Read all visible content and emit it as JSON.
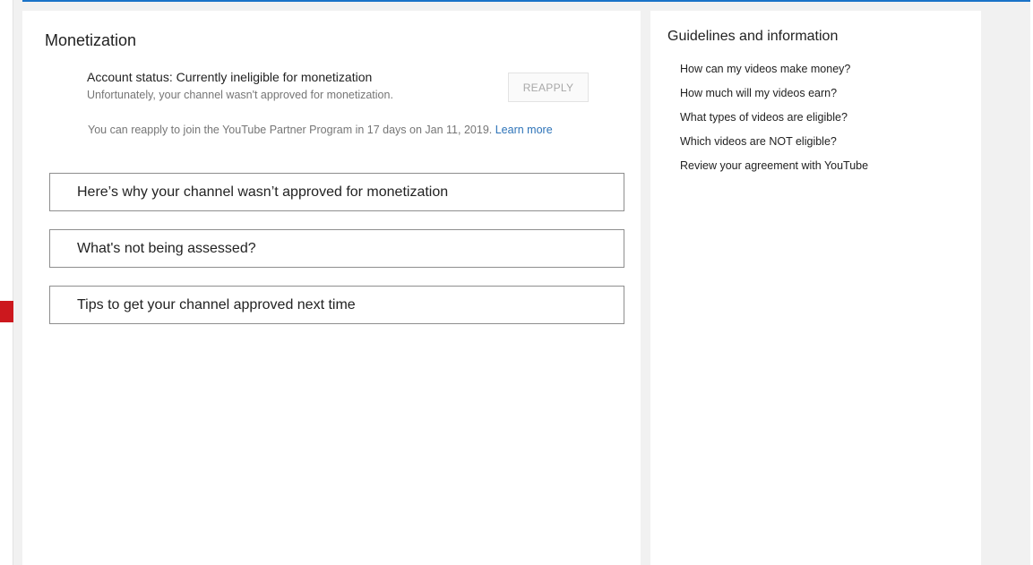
{
  "colors": {
    "accent_top": "#1a73c8",
    "brand_red": "#cc181e",
    "link": "#2d73b8"
  },
  "monetization": {
    "title": "Monetization",
    "status_text": "Account status: Currently ineligible for monetization",
    "status_subtext": "Unfortunately, your channel wasn't approved for monetization.",
    "reapply_label": "REAPPLY",
    "reapply_note": "You can reapply to join the YouTube Partner Program in 17 days on Jan 11, 2019.",
    "learn_more": "Learn more",
    "sections": [
      {
        "label": "Here’s why your channel wasn’t approved for monetization"
      },
      {
        "label": "What's not being assessed?"
      },
      {
        "label": "Tips to get your channel approved next time"
      }
    ]
  },
  "guidelines": {
    "title": "Guidelines and information",
    "links": [
      {
        "label": "How can my videos make money?"
      },
      {
        "label": "How much will my videos earn?"
      },
      {
        "label": "What types of videos are eligible?"
      },
      {
        "label": "Which videos are NOT eligible?"
      },
      {
        "label": "Review your agreement with YouTube"
      }
    ]
  }
}
